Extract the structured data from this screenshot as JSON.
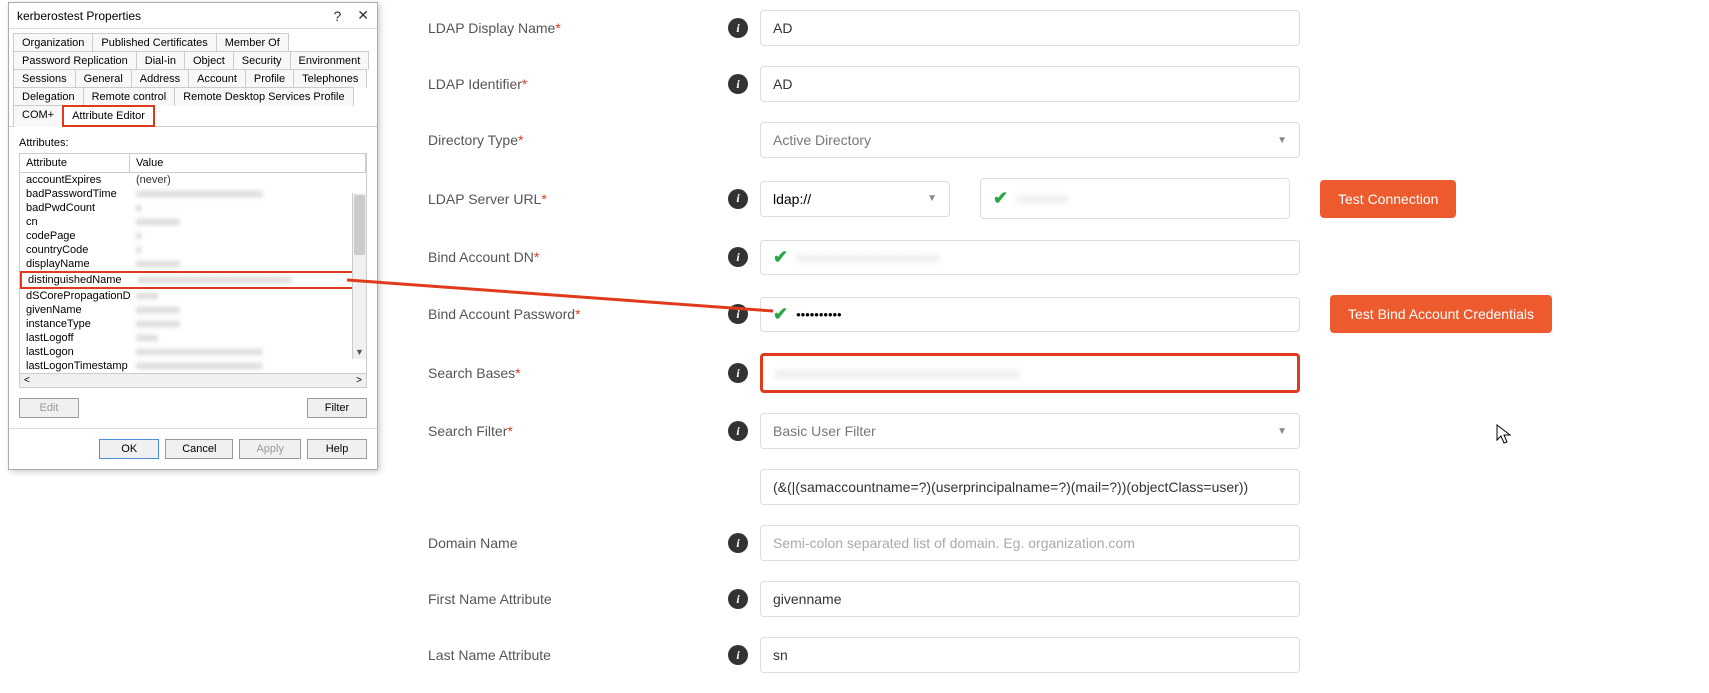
{
  "dialog": {
    "title": "kerberostest Properties",
    "tabs_row1": [
      "Organization",
      "Published Certificates",
      "Member Of",
      "Password Replication"
    ],
    "tabs_row2": [
      "Dial-in",
      "Object",
      "Security",
      "Environment",
      "Sessions"
    ],
    "tabs_row3": [
      "General",
      "Address",
      "Account",
      "Profile",
      "Telephones",
      "Delegation"
    ],
    "tabs_row4": [
      "Remote control",
      "Remote Desktop Services Profile",
      "COM+",
      "Attribute Editor"
    ],
    "active_tab": "Attribute Editor",
    "attributes_label": "Attributes:",
    "col_attribute": "Attribute",
    "col_value": "Value",
    "rows": [
      {
        "attr": "accountExpires",
        "val": "(never)",
        "clear": true
      },
      {
        "attr": "badPasswordTime",
        "val": "xxxxxxxxxxxxxxxxxxxxxxx"
      },
      {
        "attr": "badPwdCount",
        "val": "x"
      },
      {
        "attr": "cn",
        "val": "xxxxxxxx"
      },
      {
        "attr": "codePage",
        "val": "x"
      },
      {
        "attr": "countryCode",
        "val": "x"
      },
      {
        "attr": "displayName",
        "val": "xxxxxxxx"
      },
      {
        "attr": "distinguishedName",
        "val": "xxxxxxxxxxxxxxxxxxxxxxxxxxxx",
        "highlighted": true
      },
      {
        "attr": "dSCorePropagationD...",
        "val": "xxxx"
      },
      {
        "attr": "givenName",
        "val": "xxxxxxxx"
      },
      {
        "attr": "instanceType",
        "val": "xxxxxxxx"
      },
      {
        "attr": "lastLogoff",
        "val": "xxxx"
      },
      {
        "attr": "lastLogon",
        "val": "xxxxxxxxxxxxxxxxxxxxxxx"
      },
      {
        "attr": "lastLogonTimestamp",
        "val": "xxxxxxxxxxxxxxxxxxxxxxx"
      }
    ],
    "edit_btn": "Edit",
    "filter_btn": "Filter",
    "ok_btn": "OK",
    "cancel_btn": "Cancel",
    "apply_btn": "Apply",
    "help_btn": "Help"
  },
  "form": {
    "ldap_display_label": "LDAP Display Name",
    "ldap_display_value": "AD",
    "ldap_identifier_label": "LDAP Identifier",
    "ldap_identifier_value": "AD",
    "directory_type_label": "Directory Type",
    "directory_type_value": "Active Directory",
    "server_url_label": "LDAP Server URL",
    "server_url_scheme": "ldap://",
    "test_connection_btn": "Test Connection",
    "bind_dn_label": "Bind Account DN",
    "bind_pw_label": "Bind Account Password",
    "bind_pw_value": "••••••••••",
    "test_bind_btn": "Test Bind Account Credentials",
    "search_bases_label": "Search Bases",
    "search_filter_label": "Search Filter",
    "search_filter_value": "Basic User Filter",
    "filter_expr_value": "(&(|(samaccountname=?)(userprincipalname=?)(mail=?))(objectClass=user))",
    "domain_name_label": "Domain Name",
    "domain_name_placeholder": "Semi-colon separated list of domain. Eg. organization.com",
    "first_name_label": "First Name Attribute",
    "first_name_value": "givenname",
    "last_name_label": "Last Name Attribute",
    "last_name_value": "sn"
  }
}
